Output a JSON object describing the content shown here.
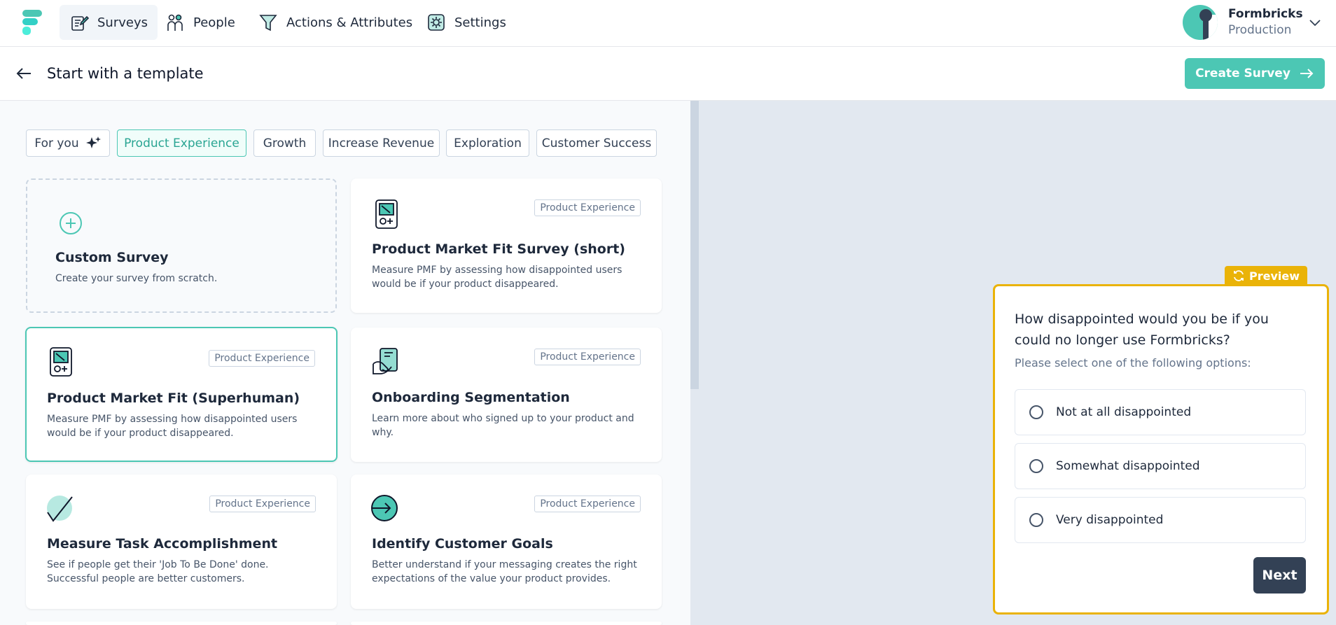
{
  "nav": {
    "items": [
      {
        "label": "Surveys",
        "icon": "survey-icon"
      },
      {
        "label": "People",
        "icon": "people-icon"
      },
      {
        "label": "Actions & Attributes",
        "icon": "filter-icon"
      },
      {
        "label": "Settings",
        "icon": "gear-icon"
      }
    ],
    "profile": {
      "name": "Formbricks",
      "environment": "Production"
    }
  },
  "header": {
    "title": "Start with a template",
    "create_label": "Create Survey"
  },
  "tabs": [
    {
      "label": "For you",
      "active": false
    },
    {
      "label": "Product Experience",
      "active": true
    },
    {
      "label": "Growth",
      "active": false
    },
    {
      "label": "Increase Revenue",
      "active": false
    },
    {
      "label": "Exploration",
      "active": false
    },
    {
      "label": "Customer Success",
      "active": false
    }
  ],
  "templates": [
    {
      "title": "Custom Survey",
      "description": "Create your survey from scratch.",
      "badge": ""
    },
    {
      "title": "Product Market Fit Survey (short)",
      "description": "Measure PMF by assessing how disappointed users would be if your product disappeared.",
      "badge": "Product Experience"
    },
    {
      "title": "Product Market Fit (Superhuman)",
      "description": "Measure PMF by assessing how disappointed users would be if your product disappeared.",
      "badge": "Product Experience"
    },
    {
      "title": "Onboarding Segmentation",
      "description": "Learn more about who signed up to your product and why.",
      "badge": "Product Experience"
    },
    {
      "title": "Measure Task Accomplishment",
      "description": "See if people get their 'Job To Be Done' done. Successful people are better customers.",
      "badge": "Product Experience"
    },
    {
      "title": "Identify Customer Goals",
      "description": "Better understand if your messaging creates the right expectations of the value your product provides.",
      "badge": "Product Experience"
    }
  ],
  "preview": {
    "label": "Preview",
    "question": "How disappointed would you be if you could no longer use Formbricks?",
    "subheader": "Please select one of the following options:",
    "options": [
      "Not at all disappointed",
      "Somewhat disappointed",
      "Very disappointed"
    ],
    "next_label": "Next"
  },
  "colors": {
    "brand": "#4cc7b4",
    "preview_accent": "#eab308",
    "dark": "#334155"
  }
}
